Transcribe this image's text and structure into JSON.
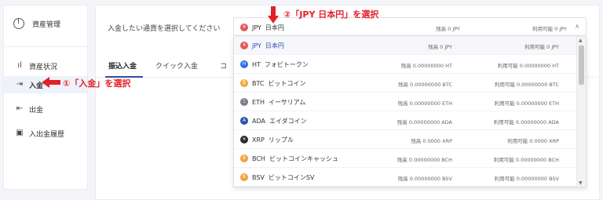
{
  "sidebar": {
    "header": "資産管理",
    "items": [
      {
        "label": "資産状況",
        "icon": "bar-chart-icon",
        "glyph": "ıl"
      },
      {
        "label": "入金",
        "icon": "deposit-icon",
        "glyph": "⇥"
      },
      {
        "label": "出金",
        "icon": "withdraw-icon",
        "glyph": "⇤"
      },
      {
        "label": "入出金履歴",
        "icon": "history-icon",
        "glyph": "▣"
      }
    ]
  },
  "main": {
    "prompt": "入金したい通貨を選択してください",
    "tabs": [
      "振込入金",
      "クイック入金",
      "コ"
    ]
  },
  "select": {
    "code": "JPY",
    "name": "日本円",
    "balance": "残高 0 JPY",
    "available": "利用可能 0 JPY"
  },
  "options": [
    {
      "code": "JPY",
      "name": "日本円",
      "balance": "残高 0 JPY",
      "available": "利用可能 0 JPY",
      "color": "#e05a5a",
      "glyph": "¥"
    },
    {
      "code": "HT",
      "name": "フォビトークン",
      "balance": "残高 0.00000000 HT",
      "available": "利用可能 0.00000000 HT",
      "color": "#2f6fe0",
      "glyph": "H"
    },
    {
      "code": "BTC",
      "name": "ビットコイン",
      "balance": "残高 0.00000000 BTC",
      "available": "利用可能 0.00000000 BTC",
      "color": "#f2a23a",
      "glyph": "₿"
    },
    {
      "code": "ETH",
      "name": "イーサリアム",
      "balance": "残高 0.00000000 ETH",
      "available": "利用可能 0.00000000 ETH",
      "color": "#7a7f8c",
      "glyph": "Ξ"
    },
    {
      "code": "ADA",
      "name": "エイダコイン",
      "balance": "残高 0.00000000 ADA",
      "available": "利用可能 0.00000000 ADA",
      "color": "#2a4fb0",
      "glyph": "A"
    },
    {
      "code": "XRP",
      "name": "リップル",
      "balance": "残高 0.0000 XRP",
      "available": "利用可能 0.0000 XRP",
      "color": "#2b2b2b",
      "glyph": "✕"
    },
    {
      "code": "BCH",
      "name": "ビットコインキャッシュ",
      "balance": "残高 0.00000000 BCH",
      "available": "利用可能 0.00000000 BCH",
      "color": "#f0a23a",
      "glyph": "B"
    },
    {
      "code": "BSV",
      "name": "ビットコインSV",
      "balance": "残高 0.00000000 BSV",
      "available": "利用可能 0.00000000 BSV",
      "color": "#f0a23a",
      "glyph": "B"
    }
  ],
  "annotations": {
    "step1": "①「入金」を選択",
    "step2": "②「JPY 日本円」を選択"
  },
  "colors": {
    "accent": "#2b4fa8",
    "annotation": "#e3202a"
  }
}
